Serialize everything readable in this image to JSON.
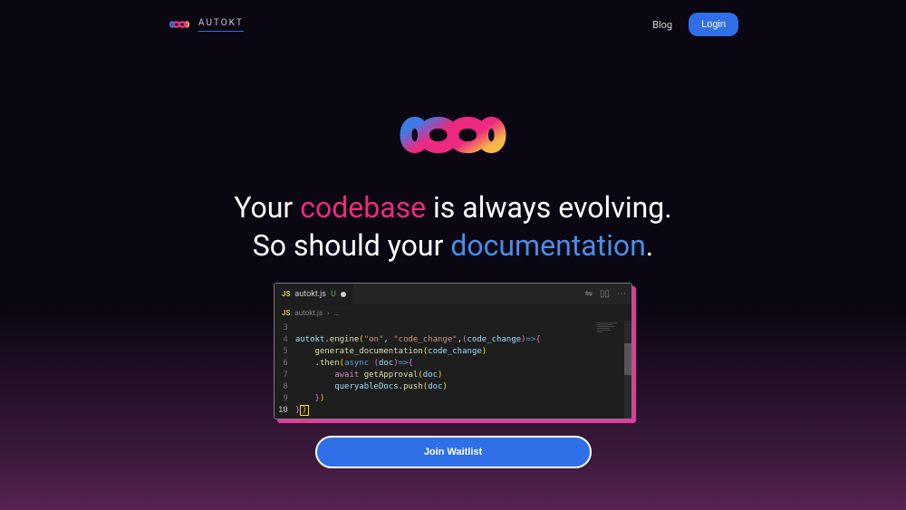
{
  "brand": "AUTOKT",
  "nav": {
    "blog": "Blog",
    "login": "Login"
  },
  "headline": {
    "part1": "Your ",
    "highlight1": "codebase",
    "part2": " is always evolving.",
    "part3": "So should your ",
    "highlight2": "documentation",
    "part4": "."
  },
  "editor": {
    "tab_icon": "JS",
    "tab_name": "autokt.js",
    "tab_status": "U",
    "breadcrumb_file": "autokt.js",
    "breadcrumb_sep": "›",
    "breadcrumb_more": "...",
    "lines": [
      "3",
      "4",
      "5",
      "6",
      "7",
      "8",
      "9",
      "10"
    ]
  },
  "cta": "Join Waitlist",
  "colors": {
    "accent_pink": "#ed2a80",
    "accent_blue": "#4a8de8"
  }
}
